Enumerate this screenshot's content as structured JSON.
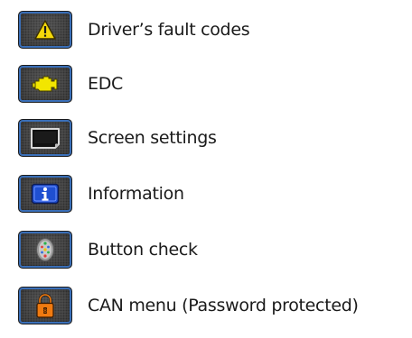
{
  "menu": {
    "items": [
      {
        "label": "Driver’s fault codes",
        "icon": "warning-triangle-icon"
      },
      {
        "label": "EDC",
        "icon": "engine-icon"
      },
      {
        "label": "Screen settings",
        "icon": "display-screen-icon"
      },
      {
        "label": "Information",
        "icon": "info-icon"
      },
      {
        "label": "Button check",
        "icon": "button-keypad-icon"
      },
      {
        "label": "CAN menu (Password protected)",
        "icon": "padlock-icon"
      }
    ]
  },
  "colors": {
    "tile_background": "#4a4a4a",
    "tile_highlight": "#3a6fb8",
    "warning_yellow": "#f5d90a",
    "engine_yellow": "#f2e600",
    "info_blue": "#1f4fd1",
    "lock_orange": "#f07a10",
    "text": "#1a1a1a"
  }
}
